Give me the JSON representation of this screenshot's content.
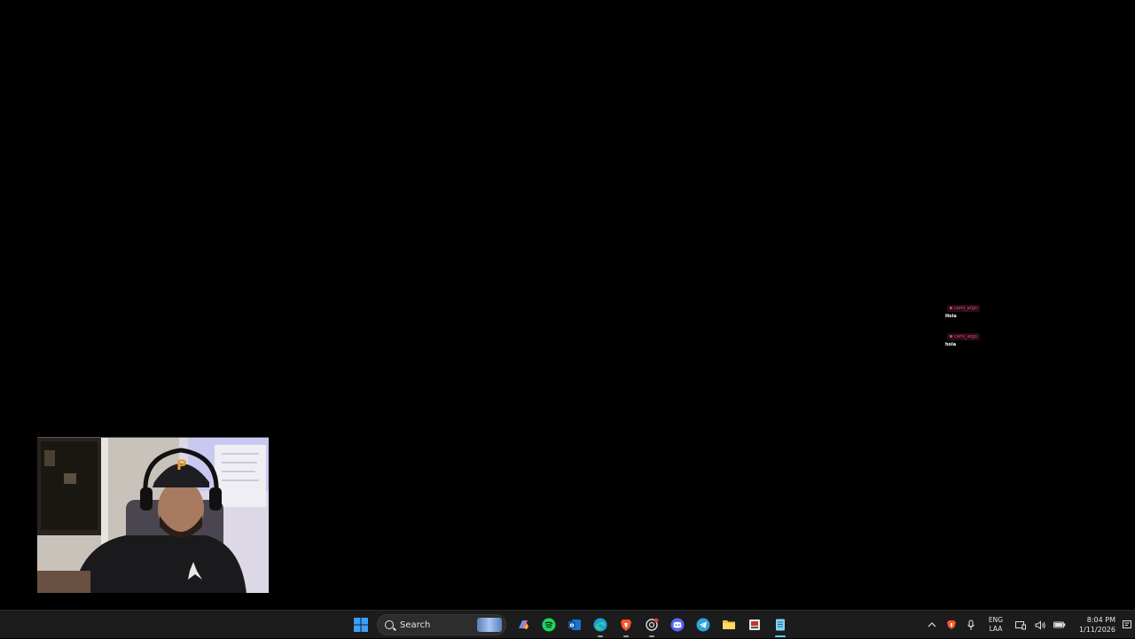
{
  "chat": {
    "messages": [
      {
        "user": "cami_argo",
        "text": "Hola"
      },
      {
        "user": "cami_argo",
        "text": "hola"
      }
    ]
  },
  "taskbar": {
    "search_label": "Search",
    "pinned": [
      "start-icon",
      "copilot-icon",
      "spotify-icon",
      "outlook-icon",
      "edge-icon",
      "brave-icon",
      "chatgpt-icon",
      "discord-icon",
      "telegram-icon",
      "file-explorer-icon",
      "media-tool-icon",
      "notepad-icon"
    ],
    "tray": {
      "language": "ENG",
      "layout": "LAA",
      "time": "8:04 PM",
      "date": "1/11/2026"
    }
  },
  "colors": {
    "taskbar_bg": "#1c1c1c",
    "accent": "#60cdff",
    "chat_username": "#d64a7a"
  }
}
